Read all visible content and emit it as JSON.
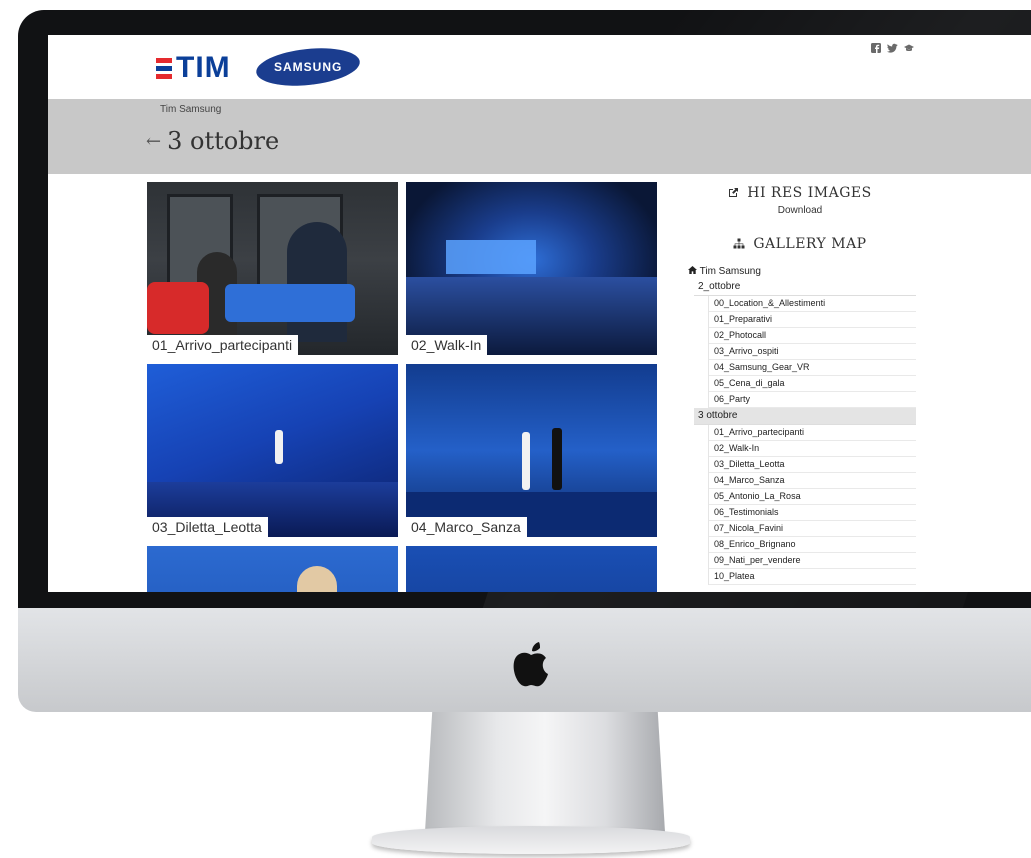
{
  "header": {
    "brand_tim": "TIM",
    "brand_samsung": "SAMSUNG",
    "social_icons": [
      "facebook-icon",
      "twitter-icon",
      "mortarboard-icon"
    ]
  },
  "breadcrumb": {
    "path": "Tim Samsung"
  },
  "page": {
    "back_symbol": "←",
    "title": "3 ottobre"
  },
  "gallery": {
    "tiles": [
      {
        "label": "01_Arrivo_partecipanti"
      },
      {
        "label": "02_Walk-In"
      },
      {
        "label": "03_Diletta_Leotta"
      },
      {
        "label": "04_Marco_Sanza"
      },
      {
        "label": ""
      },
      {
        "label": ""
      }
    ]
  },
  "sidebar": {
    "hires_title": "HI RES IMAGES",
    "hires_download": "Download",
    "map_title": "GALLERY MAP",
    "root_label": "Tim Samsung",
    "groups": [
      {
        "label": "2_ottobre",
        "items": [
          "00_Location_&_Allestimenti",
          "01_Preparativi",
          "02_Photocall",
          "03_Arrivo_ospiti",
          "04_Samsung_Gear_VR",
          "05_Cena_di_gala",
          "06_Party"
        ]
      },
      {
        "label": "3 ottobre",
        "items": [
          "01_Arrivo_partecipanti",
          "02_Walk-In",
          "03_Diletta_Leotta",
          "04_Marco_Sanza",
          "05_Antonio_La_Rosa",
          "06_Testimonials",
          "07_Nicola_Favini",
          "08_Enrico_Brignano",
          "09_Nati_per_vendere",
          "10_Platea"
        ]
      }
    ]
  },
  "colors": {
    "tim_red": "#e52a2e",
    "tim_blue": "#0b3f99",
    "samsung_blue": "#1b3d8f",
    "breadcrumb_bar": "#c8c8c8"
  }
}
